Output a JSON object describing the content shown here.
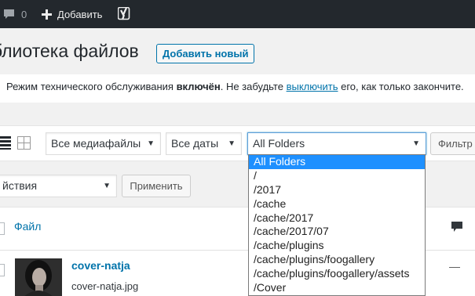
{
  "adminbar": {
    "comments_count": "0",
    "new_label": "Добавить"
  },
  "header": {
    "title": "блиотека файлов",
    "add_new_label": "Добавить новый"
  },
  "notice": {
    "text_before": "Режим технического обслуживания ",
    "bold": "включён",
    "text_middle": ". Не забудьте ",
    "link": "выключить",
    "text_after": " его, как только закончите."
  },
  "filters": {
    "media_type": "Все медиафайлы",
    "dates": "Все даты",
    "folders": "All Folders",
    "filter_button": "Фильтр"
  },
  "bulk": {
    "action": "йствия",
    "apply_button": "Применить"
  },
  "table": {
    "column_file": "Файл",
    "rows": [
      {
        "title": "cover-natja",
        "filename": "cover-natja.jpg",
        "comments": "—"
      }
    ]
  },
  "folder_options": [
    "All Folders",
    "/",
    "/2017",
    "/cache",
    "/cache/2017",
    "/cache/2017/07",
    "/cache/plugins",
    "/cache/plugins/foogallery",
    "/cache/plugins/foogallery/assets",
    "/Cover"
  ],
  "colors": {
    "adminbar_bg": "#23282d",
    "link": "#0073aa",
    "selected_option": "#1e90ff",
    "notice_border": "#ffb900"
  }
}
